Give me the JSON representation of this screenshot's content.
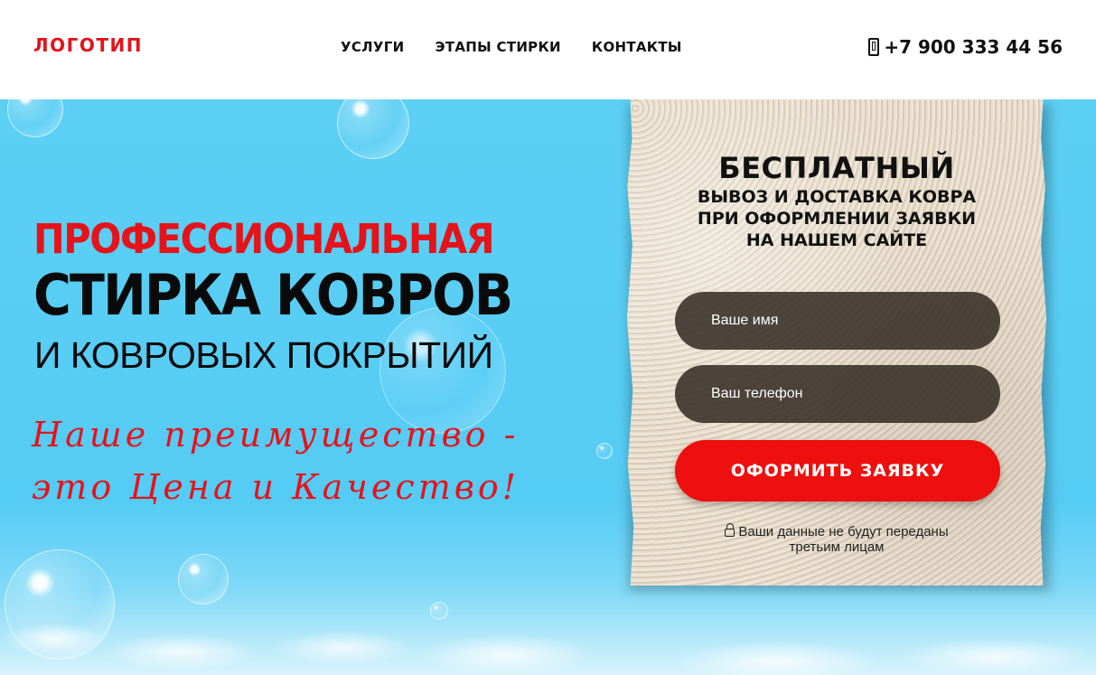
{
  "header": {
    "logo": "ЛОГОТИП",
    "nav": [
      "УСЛУГИ",
      "ЭТАПЫ СТИРКИ",
      "КОНТАКТЫ"
    ],
    "phone": "+7 900 333 44 56"
  },
  "hero": {
    "title_line1": "ПРОФЕССИОНАЛЬНАЯ",
    "title_line2": "СТИРКА КОВРОВ",
    "title_line3": "И КОВРОВЫХ ПОКРЫТИЙ",
    "slogan_line1": "Наше преимущество -",
    "slogan_line2": "это Цена и Качество!"
  },
  "form": {
    "offer_title": "БЕСПЛАТНЫЙ",
    "offer_line1": "ВЫВОЗ И ДОСТАВКА КОВРА",
    "offer_line2": "ПРИ ОФОРМЛЕНИИ ЗАЯВКИ",
    "offer_line3": "НА НАШЕМ САЙТЕ",
    "name_placeholder": "Ваше имя",
    "phone_placeholder": "Ваш телефон",
    "submit_label": "ОФОРМИТЬ ЗАЯВКУ",
    "privacy_line1": "Ваши данные не будут переданы",
    "privacy_line2": "третьим лицам"
  },
  "colors": {
    "accent": "#e5131a",
    "button": "#ee0f0f",
    "hero_bg": "#5ccff4",
    "field_bg": "#372d26"
  }
}
